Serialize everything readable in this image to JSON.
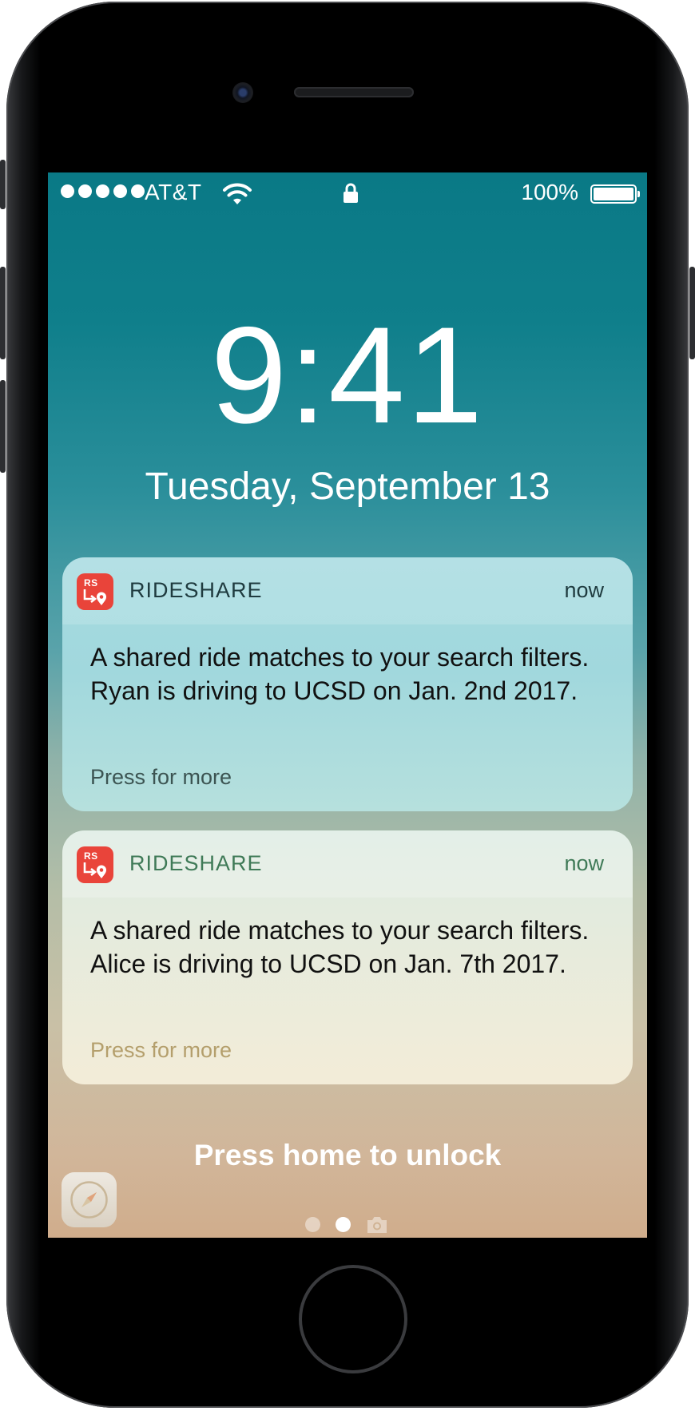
{
  "status_bar": {
    "carrier": "AT&T",
    "battery_percent": "100%",
    "signal_bars": 5,
    "icons": [
      "signal-dots-icon",
      "wifi-icon",
      "lock-icon",
      "battery-icon"
    ]
  },
  "lock_screen": {
    "time": "9:41",
    "date": "Tuesday, September 13"
  },
  "notifications": [
    {
      "app_icon_text": "RS",
      "app_name": "RIDESHARE",
      "time": "now",
      "message": "A shared ride matches to your search filters. Ryan is driving to UCSD on Jan. 2nd 2017.",
      "action_hint": "Press for more"
    },
    {
      "app_icon_text": "RS",
      "app_name": "RIDESHARE",
      "time": "now",
      "message": "A shared ride matches to your search filters. Alice is driving to UCSD on Jan. 7th 2017.",
      "action_hint": "Press for more"
    }
  ],
  "bottom": {
    "unlock_hint": "Press home to unlock",
    "shortcut_icon": "safari-icon",
    "page_count": 2,
    "active_page": 2,
    "camera_icon": "camera-icon"
  },
  "colors": {
    "app_icon_bg": "#e9443a",
    "wallpaper_top": "#0a7986",
    "wallpaper_bottom": "#d0ad8c"
  }
}
